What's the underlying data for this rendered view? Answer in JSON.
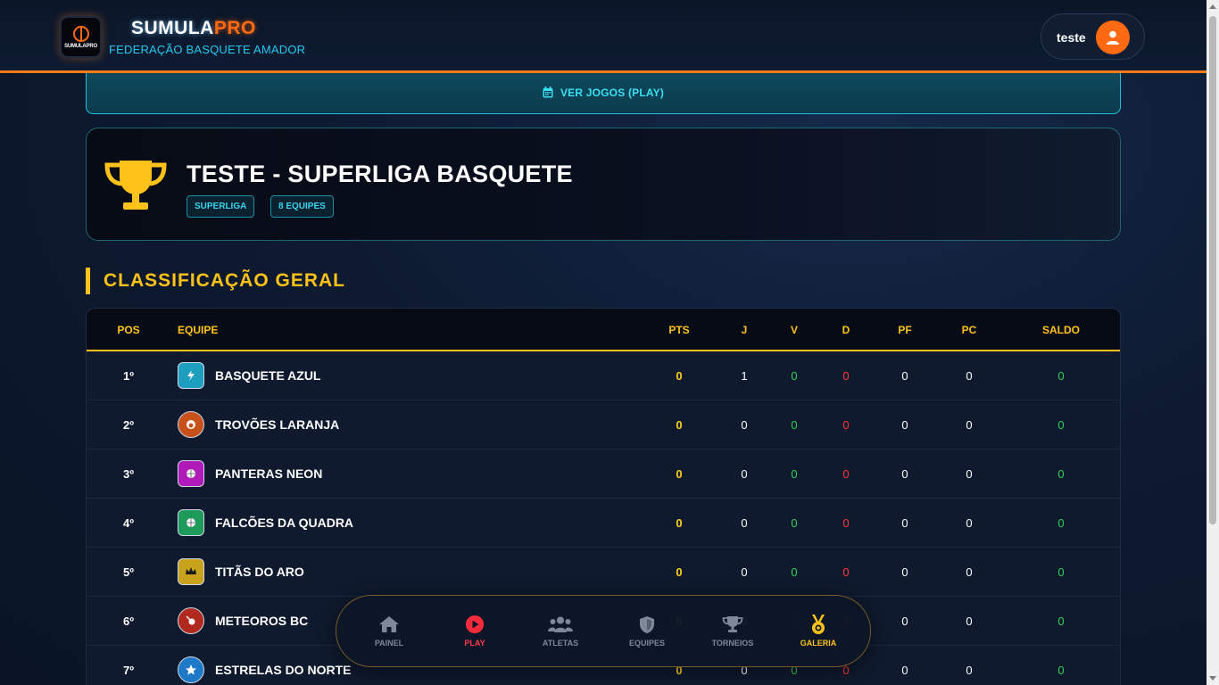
{
  "header": {
    "brand_part1": "SUMULA",
    "brand_part2": "PRO",
    "subtitle": "FEDERAÇÃO BASQUETE AMADOR",
    "logo_text": "SUMULAPRO",
    "user_name": "teste"
  },
  "play_button": {
    "label": "VER JOGOS (PLAY)",
    "icon": "calendar-icon"
  },
  "tournament": {
    "title": "TESTE - SUPERLIGA BASQUETE",
    "tags": [
      "SUPERLIGA",
      "8 EQUIPES"
    ],
    "icon": "trophy-icon"
  },
  "section": {
    "title": "CLASSIFICAÇÃO GERAL"
  },
  "table": {
    "headers": {
      "pos": "POS",
      "equipe": "EQUIPE",
      "pts": "PTS",
      "j": "J",
      "v": "V",
      "d": "D",
      "pf": "PF",
      "pc": "PC",
      "saldo": "SALDO"
    },
    "rows": [
      {
        "pos": "1º",
        "team": "BASQUETE AZUL",
        "pts": "0",
        "j": "1",
        "v": "0",
        "d": "0",
        "pf": "0",
        "pc": "0",
        "saldo": "0",
        "badge_color": "#1e9fc0",
        "badge_icon": "lightning-icon"
      },
      {
        "pos": "2º",
        "team": "TROVÕES LARANJA",
        "pts": "0",
        "j": "0",
        "v": "0",
        "d": "0",
        "pf": "0",
        "pc": "0",
        "saldo": "0",
        "badge_color": "#c8501a",
        "badge_icon": "flame-icon"
      },
      {
        "pos": "3º",
        "team": "PANTERAS NEON",
        "pts": "0",
        "j": "0",
        "v": "0",
        "d": "0",
        "pf": "0",
        "pc": "0",
        "saldo": "0",
        "badge_color": "#b01ab8",
        "badge_icon": "basketball-icon"
      },
      {
        "pos": "4º",
        "team": "FALCÕES DA QUADRA",
        "pts": "0",
        "j": "0",
        "v": "0",
        "d": "0",
        "pf": "0",
        "pc": "0",
        "saldo": "0",
        "badge_color": "#1e9a5a",
        "badge_icon": "basketball-icon"
      },
      {
        "pos": "5º",
        "team": "TITÃS DO ARO",
        "pts": "0",
        "j": "0",
        "v": "0",
        "d": "0",
        "pf": "0",
        "pc": "0",
        "saldo": "0",
        "badge_color": "#c8a21a",
        "badge_icon": "crown-icon"
      },
      {
        "pos": "6º",
        "team": "METEOROS BC",
        "pts": "0",
        "j": "0",
        "v": "0",
        "d": "0",
        "pf": "0",
        "pc": "0",
        "saldo": "0",
        "badge_color": "#b0281e",
        "badge_icon": "meteor-icon"
      },
      {
        "pos": "7º",
        "team": "ESTRELAS DO NORTE",
        "pts": "0",
        "j": "0",
        "v": "0",
        "d": "0",
        "pf": "0",
        "pc": "0",
        "saldo": "0",
        "badge_color": "#1e7ac8",
        "badge_icon": "star-icon"
      }
    ]
  },
  "bottom_nav": {
    "items": [
      {
        "label": "PAINEL",
        "icon": "home-icon"
      },
      {
        "label": "PLAY",
        "icon": "play-icon"
      },
      {
        "label": "ATLETAS",
        "icon": "users-icon"
      },
      {
        "label": "EQUIPES",
        "icon": "shield-icon"
      },
      {
        "label": "TORNEIOS",
        "icon": "trophy-icon"
      },
      {
        "label": "GALERIA",
        "icon": "medal-icon"
      }
    ]
  },
  "colors": {
    "accent_orange": "#ff6a13",
    "accent_gold": "#ffc21a",
    "accent_cyan": "#38e1f2",
    "win_green": "#2fd15a",
    "loss_red": "#ff3a3a"
  }
}
